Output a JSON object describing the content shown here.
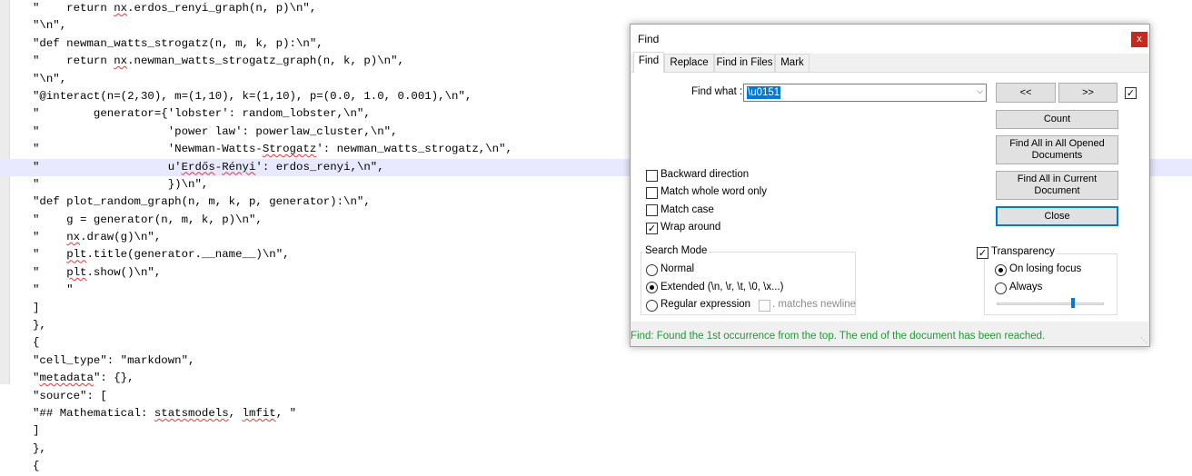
{
  "editor": {
    "lines": [
      "\"    return nx.erdos_renyi_graph(n, p)\\n\",",
      "\"\\n\",",
      "\"def newman_watts_strogatz(n, m, k, p):\\n\",",
      "\"    return nx.newman_watts_strogatz_graph(n, k, p)\\n\",",
      "\"\\n\",",
      "\"@interact(n=(2,30), m=(1,10), k=(1,10), p=(0.0, 1.0, 0.001),\\n\",",
      "\"        generator={'lobster': random_lobster,\\n\",",
      "\"                   'power law': powerlaw_cluster,\\n\",",
      "\"                   'Newman-Watts-Strogatz': newman_watts_strogatz,\\n\",",
      "\"                   u'Erdős-Rényi': erdos_renyi,\\n\",",
      "\"                   })\\n\",",
      "\"def plot_random_graph(n, m, k, p, generator):\\n\",",
      "\"    g = generator(n, m, k, p)\\n\",",
      "\"    nx.draw(g)\\n\",",
      "\"    plt.title(generator.__name__)\\n\",",
      "\"    plt.show()\\n\",",
      "\"    \"",
      "]",
      "},",
      "{",
      "\"cell_type\": \"markdown\",",
      "\"metadata\": {},",
      "\"source\": [",
      "\"## Mathematical: statsmodels, lmfit, \"",
      "]",
      "},",
      "{"
    ]
  },
  "dialog": {
    "title": "Find",
    "close_glyph": "x",
    "tabs": [
      "Find",
      "Replace",
      "Find in Files",
      "Mark"
    ],
    "find_what_label": "Find what :",
    "find_what_value": "\\u0151",
    "prev_button": "<<",
    "next_button": ">>",
    "count_button": "Count",
    "find_all_opened_button": "Find All in All Opened Documents",
    "find_all_current_button": "Find All in Current Document",
    "close_button": "Close",
    "options": {
      "backward": "Backward direction",
      "whole_word": "Match whole word only",
      "match_case": "Match case",
      "wrap_around": "Wrap around"
    },
    "search_mode": {
      "title": "Search Mode",
      "normal": "Normal",
      "extended": "Extended (\\n, \\r, \\t, \\0, \\x...)",
      "regex": "Regular expression",
      "matches_newline": ". matches newline"
    },
    "transparency": {
      "title": "Transparency",
      "on_losing_focus": "On losing focus",
      "always": "Always",
      "slider_level": 0.72
    },
    "status": "Find: Found the 1st occurrence from the top. The end of the document has been reached."
  }
}
